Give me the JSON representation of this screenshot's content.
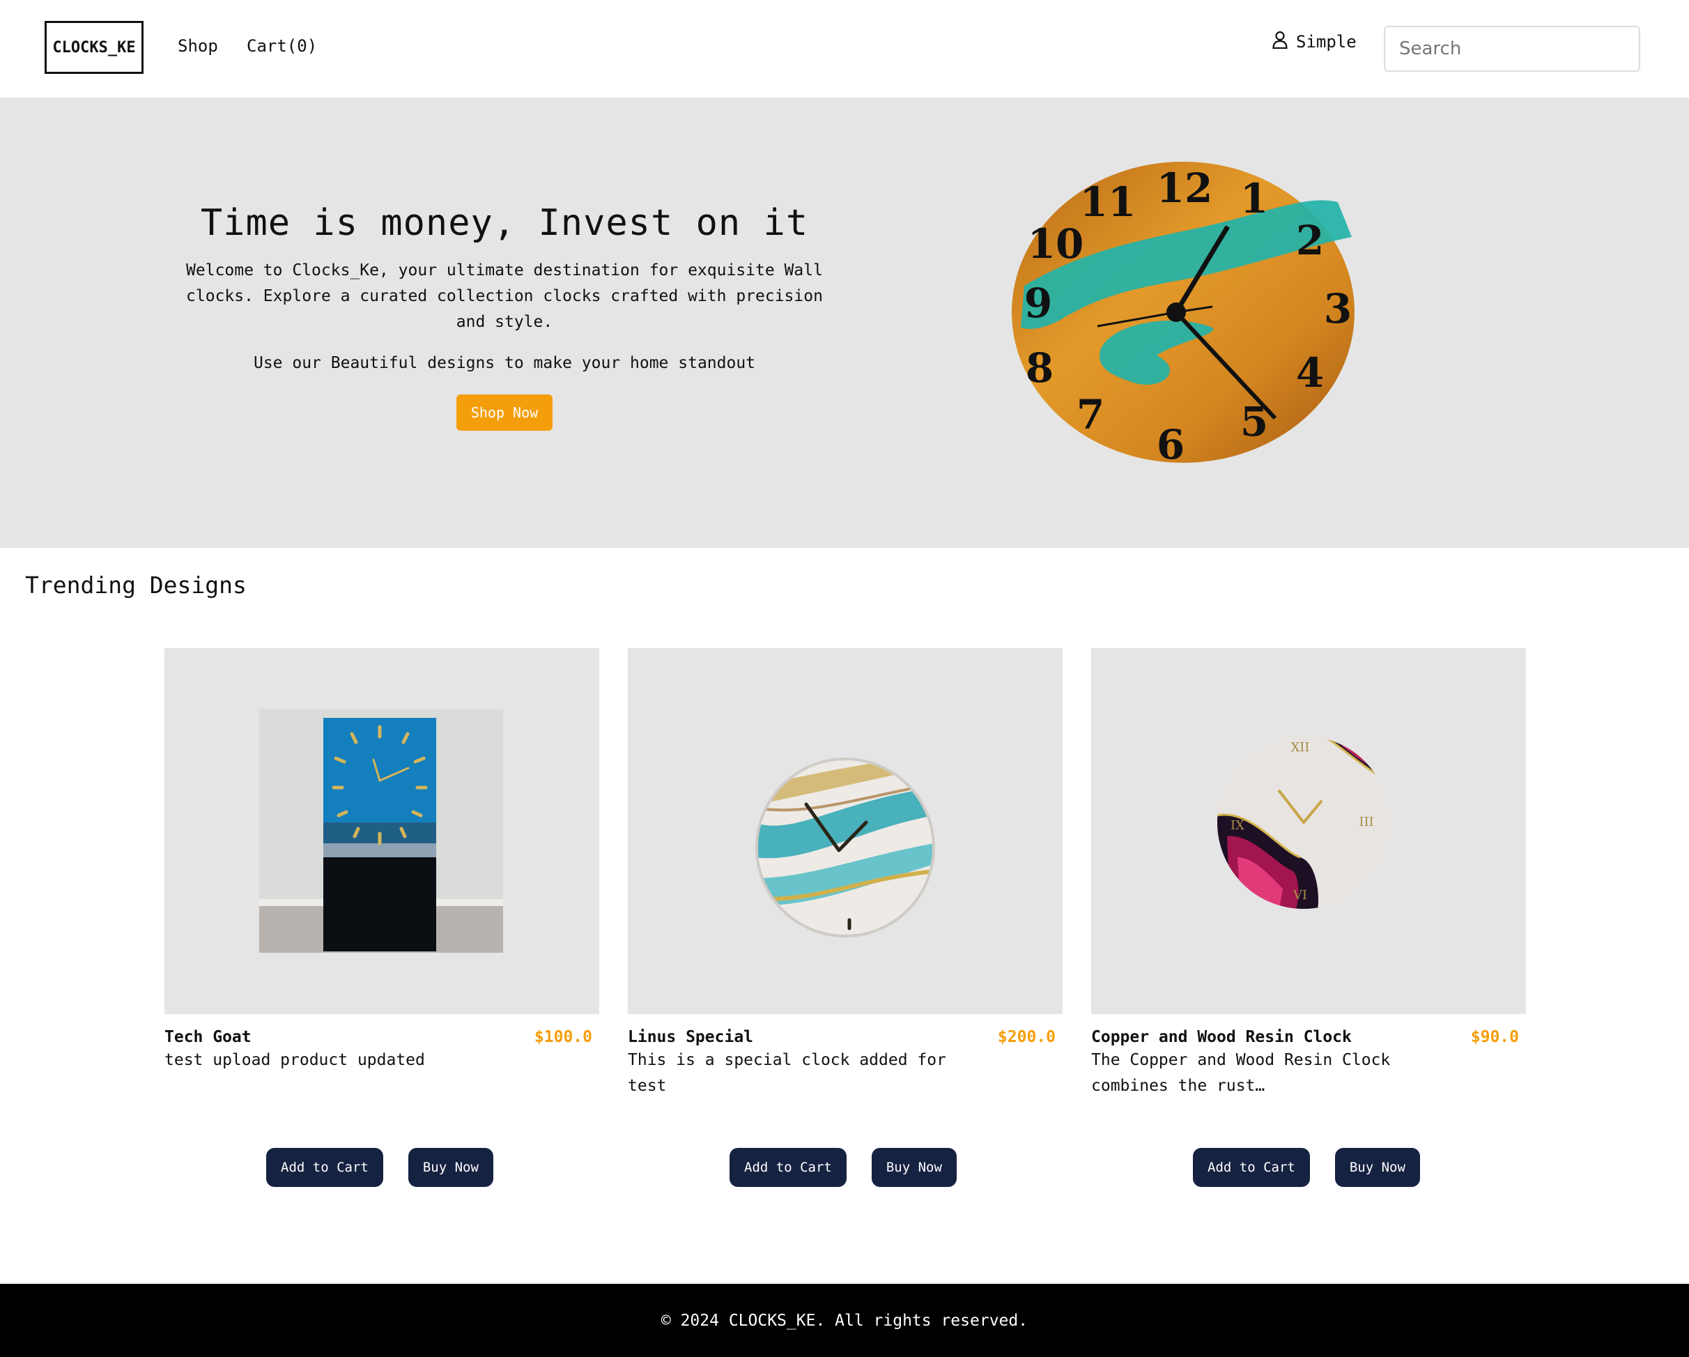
{
  "nav": {
    "logo": "CLOCKS_KE",
    "links": [
      "Shop",
      "Cart(0)"
    ],
    "user_name": "Simple",
    "search_placeholder": "Search"
  },
  "hero": {
    "title": "Time is money, Invest on it",
    "intro": "Welcome to Clocks_Ke, your ultimate destination for exquisite Wall clocks. Explore a curated collection clocks crafted with precision and style.",
    "tagline": "Use our Beautiful designs to make your home standout",
    "cta_label": "Shop Now"
  },
  "trending": {
    "title": "Trending Designs",
    "add_label": "Add to Cart",
    "buy_label": "Buy Now",
    "products": [
      {
        "name": "Tech Goat",
        "price": "$100.0",
        "description": "test upload product updated"
      },
      {
        "name": "Linus Special",
        "price": "$200.0",
        "description": "This is a special clock added for test"
      },
      {
        "name": "Copper and Wood Resin Clock",
        "price": "$90.0",
        "description": "The Copper and Wood Resin Clock combines the rust…"
      }
    ]
  },
  "footer": {
    "text": "© 2024 CLOCKS_KE. All rights reserved."
  },
  "colors": {
    "accent": "#f59e0b",
    "button_dark": "#162241",
    "hero_bg": "#e5e5e5",
    "footer_bg": "#000000"
  }
}
